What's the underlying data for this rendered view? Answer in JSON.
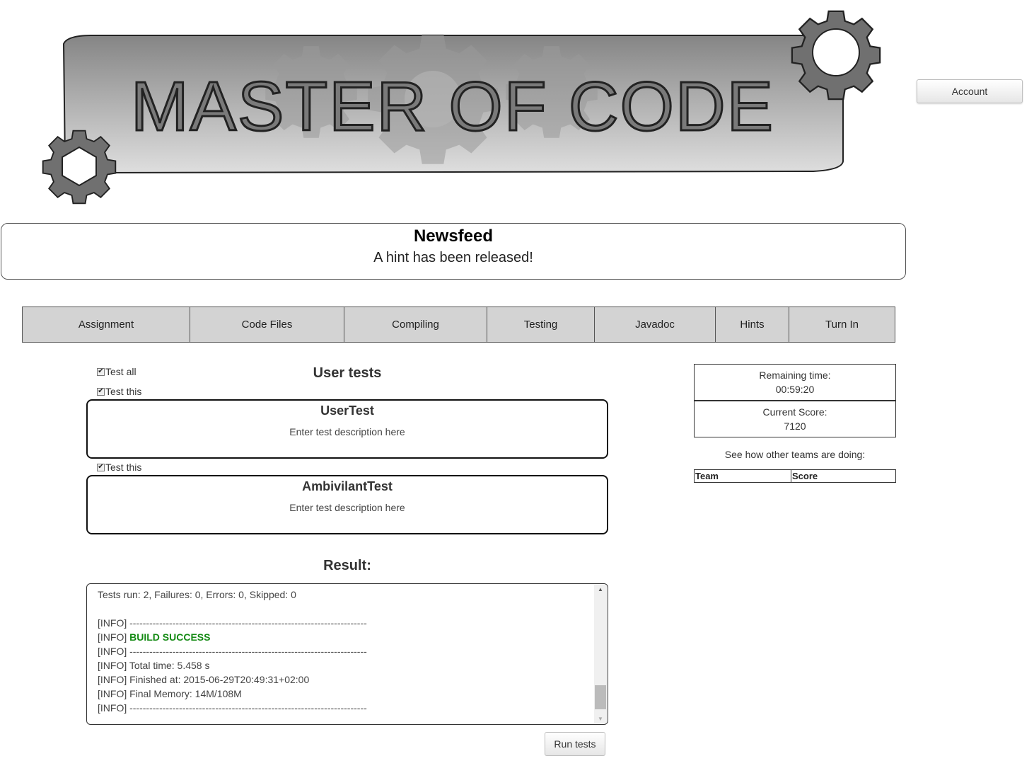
{
  "header": {
    "logo_text": "MASTER OF CODE",
    "account_label": "Account"
  },
  "newsfeed": {
    "title": "Newsfeed",
    "message": "A hint has been released!"
  },
  "tabs": [
    {
      "label": "Assignment"
    },
    {
      "label": "Code Files"
    },
    {
      "label": "Compiling"
    },
    {
      "label": "Testing"
    },
    {
      "label": "Javadoc"
    },
    {
      "label": "Hints"
    },
    {
      "label": "Turn In"
    }
  ],
  "tests": {
    "title": "User tests",
    "test_all_label": "Test all",
    "items": [
      {
        "checkbox_label": "Test this",
        "name": "UserTest",
        "description": "Enter test description here",
        "checked": true
      },
      {
        "checkbox_label": "Test this",
        "name": "AmbivilantTest",
        "description": "Enter test description here",
        "checked": true
      }
    ]
  },
  "result": {
    "title": "Result:",
    "lines": [
      "Tests run: 2, Failures: 0, Errors: 0, Skipped: 0",
      "",
      "[INFO] ------------------------------------------------------------------------",
      "[INFO] BUILD SUCCESS",
      "[INFO] ------------------------------------------------------------------------",
      "[INFO] Total time: 5.458 s",
      "[INFO] Finished at: 2015-06-29T20:49:31+02:00",
      "[INFO] Final Memory: 14M/108M",
      "[INFO] ------------------------------------------------------------------------"
    ],
    "success_prefix": "[INFO] ",
    "success_text": "BUILD SUCCESS",
    "run_button": "Run tests"
  },
  "sidebar": {
    "remaining_label": "Remaining time:",
    "remaining_value": "00:59:20",
    "score_label": "Current Score:",
    "score_value": "7120",
    "teams_caption": "See how other teams are doing:",
    "teams_columns": [
      "Team",
      "Score"
    ]
  }
}
